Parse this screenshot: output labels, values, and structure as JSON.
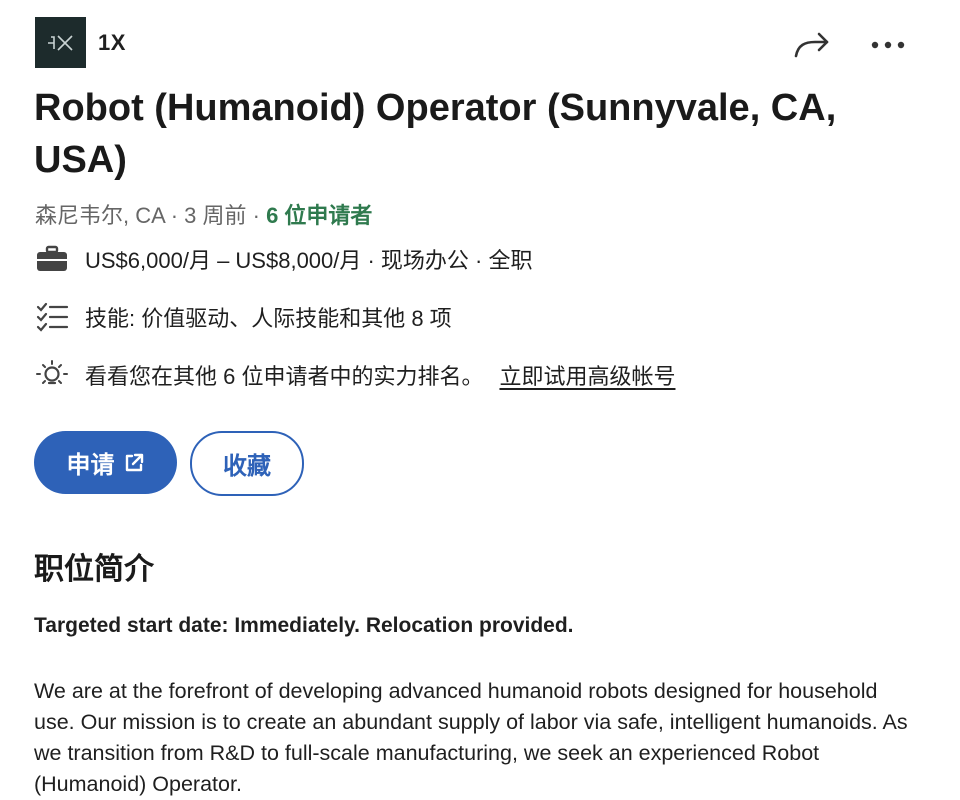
{
  "header": {
    "logo_text": "1X",
    "company": "1X",
    "share_icon": "share-arrow-icon",
    "more_icon": "more-dots-icon"
  },
  "job": {
    "title": "Robot (Humanoid) Operator (Sunnyvale, CA, USA)",
    "location": "森尼韦尔, CA",
    "posted": "3 周前",
    "applicants": "6 位申请者",
    "separator": " · ",
    "salary_line": "US$6,000/月 – US$8,000/月 · 现场办公 · 全职",
    "skills_line": "技能: 价值驱动、人际技能和其他 8 项",
    "insight_line": "看看您在其他 6 位申请者中的实力排名。",
    "premium_link": "立即试用高级帐号"
  },
  "actions": {
    "apply_label": "申请",
    "save_label": "收藏"
  },
  "description": {
    "heading": "职位简介",
    "lead": "Targeted start date: Immediately. Relocation provided.",
    "body": "We are at the forefront of developing advanced humanoid robots designed for household use. Our mission is to create an abundant supply of labor via safe, intelligent humanoids. As we transition from R&D to full-scale manufacturing, we seek an experienced Robot (Humanoid) Operator."
  },
  "colors": {
    "accent": "#2e62b8",
    "applicants_green": "#2f7a4e",
    "logo_bg": "#1d2b2c"
  }
}
